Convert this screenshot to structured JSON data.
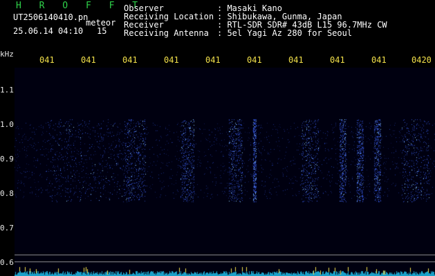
{
  "header": {
    "brand": "H R O F F T",
    "filename": "UT2506140410.pn",
    "mode": "meteor",
    "timestamp": "25.06.14 04:10",
    "count": "15",
    "info": [
      {
        "label": "Observer",
        "value": ": Masaki Kano"
      },
      {
        "label": "Receiving Location",
        "value": ": Shibukawa, Gunma, Japan"
      },
      {
        "label": "Receiver",
        "value": ": RTL-SDR SDR# 43dB L15 96.7MHz CW"
      },
      {
        "label": "Receiving Antenna",
        "value": ": 5el Yagi Az 280 for Seoul"
      }
    ]
  },
  "time_axis": {
    "labels": [
      "041",
      "041",
      "041",
      "041",
      "041",
      "041",
      "041",
      "041",
      "041",
      "0420"
    ]
  },
  "freq_axis": {
    "unit": "kHz",
    "labels": [
      "1.1",
      "1.0",
      "0.9",
      "0.8",
      "0.7",
      "0.6"
    ]
  },
  "colors": {
    "brand": "#2fd24a",
    "ticks": "#f2e04a",
    "signal": "#3a6cff"
  }
}
